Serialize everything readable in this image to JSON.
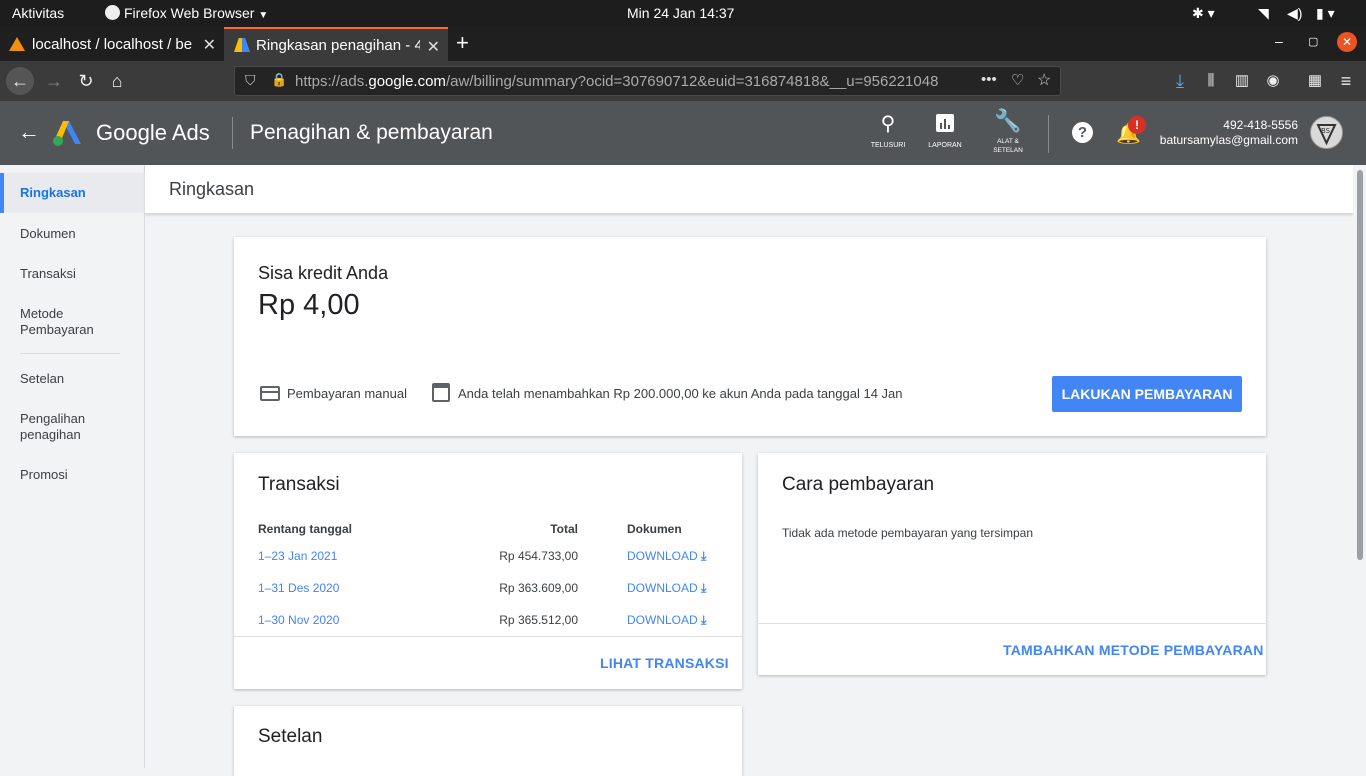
{
  "system_bar": {
    "activities": "Aktivitas",
    "app_menu": "Firefox Web Browser",
    "datetime": "Min 24 Jan  14:37"
  },
  "browser": {
    "tabs": [
      {
        "title": "localhost / localhost / be"
      },
      {
        "title": "Ringkasan penagihan - 4"
      }
    ],
    "url_prefix": "https://ads.",
    "url_domain": "google.com",
    "url_path": "/aw/billing/summary?ocid=307690712&euid=316874818&__u=956221048"
  },
  "header": {
    "product_google": "Google",
    "product_ads": "Ads",
    "page_title": "Penagihan & pembayaran",
    "tools": [
      {
        "label": "TELUSURI",
        "icon": "search-icon"
      },
      {
        "label": "LAPORAN",
        "icon": "reports-icon"
      },
      {
        "label": "ALAT &",
        "label2": "SETELAN",
        "icon": "wrench-icon"
      }
    ],
    "account_id": "492-418-5556",
    "account_email": "batursamylas@gmail.com",
    "notification_badge": "!"
  },
  "sidebar": {
    "items": [
      {
        "label": "Ringkasan",
        "active": true
      },
      {
        "label": "Dokumen"
      },
      {
        "label": "Transaksi"
      },
      {
        "label": "Metode",
        "label2": "Pembayaran"
      },
      {
        "label": "Setelan"
      },
      {
        "label": "Pengalihan",
        "label2": "penagihan"
      },
      {
        "label": "Promosi"
      }
    ]
  },
  "main": {
    "title": "Ringkasan",
    "credit": {
      "heading": "Sisa kredit Anda",
      "amount": "Rp 4,00",
      "payment_mode": "Pembayaran manual",
      "note": "Anda telah menambahkan Rp 200.000,00 ke akun Anda pada tanggal 14 Jan",
      "pay_button": "LAKUKAN PEMBAYARAN"
    },
    "transactions": {
      "heading": "Transaksi",
      "columns": [
        "Rentang tanggal",
        "Total",
        "Dokumen"
      ],
      "rows": [
        {
          "range": "1–23 Jan 2021",
          "total": "Rp 454.733,00",
          "doc": "DOWNLOAD"
        },
        {
          "range": "1–31 Des 2020",
          "total": "Rp 363.609,00",
          "doc": "DOWNLOAD"
        },
        {
          "range": "1–30 Nov 2020",
          "total": "Rp 365.512,00",
          "doc": "DOWNLOAD"
        }
      ],
      "view_all": "LIHAT TRANSAKSI"
    },
    "payment_method": {
      "heading": "Cara pembayaran",
      "empty_text": "Tidak ada metode pembayaran yang tersimpan",
      "add_button": "TAMBAHKAN METODE PEMBAYARAN"
    },
    "settings": {
      "heading": "Setelan"
    }
  },
  "colors": {
    "accent": "#4285f4",
    "header_bg": "#525558",
    "firefox_tab_accent": "#ff6633"
  }
}
